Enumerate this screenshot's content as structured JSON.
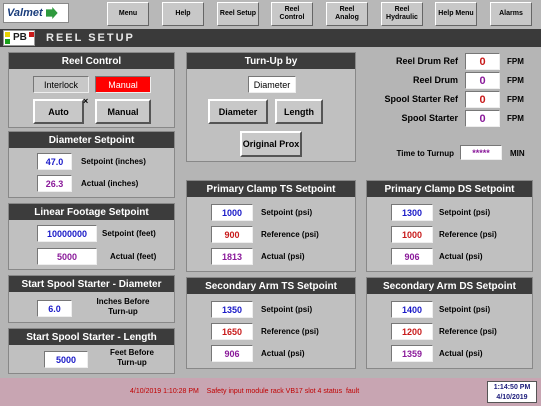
{
  "logo": "Valmet",
  "nav": [
    "Menu",
    "Help",
    "Reel Setup",
    "Reel Control",
    "Reel Analog",
    "Reel Hydraulic",
    "Help Menu",
    "Alarms"
  ],
  "badge": "PB",
  "page_title": "REEL SETUP",
  "reel_control": {
    "title": "Reel Control",
    "interlock": "Interlock",
    "manual_indicator": "Manual",
    "auto_btn": "Auto",
    "x_mark": "×",
    "manual_btn": "Manual"
  },
  "diameter_setpoint": {
    "title": "Diameter Setpoint",
    "setpoint": "47.0",
    "setpoint_label": "Setpoint (inches)",
    "actual": "26.3",
    "actual_label": "Actual (inches)"
  },
  "linear_footage": {
    "title": "Linear Footage Setpoint",
    "setpoint": "10000000",
    "setpoint_label": "Setpoint (feet)",
    "actual": "5000",
    "actual_label": "Actual (feet)"
  },
  "spool_diameter": {
    "title": "Start Spool Starter - Diameter",
    "value": "6.0",
    "label": "Inches Before Turn-up"
  },
  "spool_length": {
    "title": "Start Spool Starter - Length",
    "value": "5000",
    "label": "Feet Before Turn-up"
  },
  "turnup": {
    "title": "Turn-Up by",
    "selected": "Diameter",
    "diameter_btn": "Diameter",
    "length_btn": "Length",
    "original_prox_btn": "Original Prox"
  },
  "readouts": [
    {
      "label": "Reel Drum Ref",
      "value": "0",
      "unit": "FPM"
    },
    {
      "label": "Reel Drum",
      "value": "0",
      "unit": "FPM"
    },
    {
      "label": "Spool Starter Ref",
      "value": "0",
      "unit": "FPM"
    },
    {
      "label": "Spool Starter",
      "value": "0",
      "unit": "FPM"
    }
  ],
  "time_to_turnup": {
    "label": "Time to Turnup",
    "value": "*****",
    "unit": "MIN"
  },
  "primary_clamp_ts": {
    "title": "Primary Clamp TS Setpoint",
    "setpoint": "1000",
    "setpoint_label": "Setpoint (psi)",
    "reference": "900",
    "reference_label": "Reference (psi)",
    "actual": "1813",
    "actual_label": "Actual (psi)"
  },
  "primary_clamp_ds": {
    "title": "Primary Clamp DS Setpoint",
    "setpoint": "1300",
    "setpoint_label": "Setpoint (psi)",
    "reference": "1000",
    "reference_label": "Reference (psi)",
    "actual": "906",
    "actual_label": "Actual (psi)"
  },
  "secondary_arm_ts": {
    "title": "Secondary Arm TS Setpoint",
    "setpoint": "1350",
    "setpoint_label": "Setpoint (psi)",
    "reference": "1650",
    "reference_label": "Reference (psi)",
    "actual": "906",
    "actual_label": "Actual (psi)"
  },
  "secondary_arm_ds": {
    "title": "Secondary Arm DS Setpoint",
    "setpoint": "1400",
    "setpoint_label": "Setpoint (psi)",
    "reference": "1200",
    "reference_label": "Reference (psi)",
    "actual": "1359",
    "actual_label": "Actual (psi)"
  },
  "status": {
    "message": "4/10/2019 1:10:28 PM    Safety input module rack VB17 slot 4 status  fault",
    "time": "1:14:50 PM",
    "date": "4/10/2019"
  },
  "colors": {
    "manual_indicator_bg": "#ff0000",
    "header_bg": "#3c3c3c",
    "status_bg": "#c8a5b2"
  }
}
